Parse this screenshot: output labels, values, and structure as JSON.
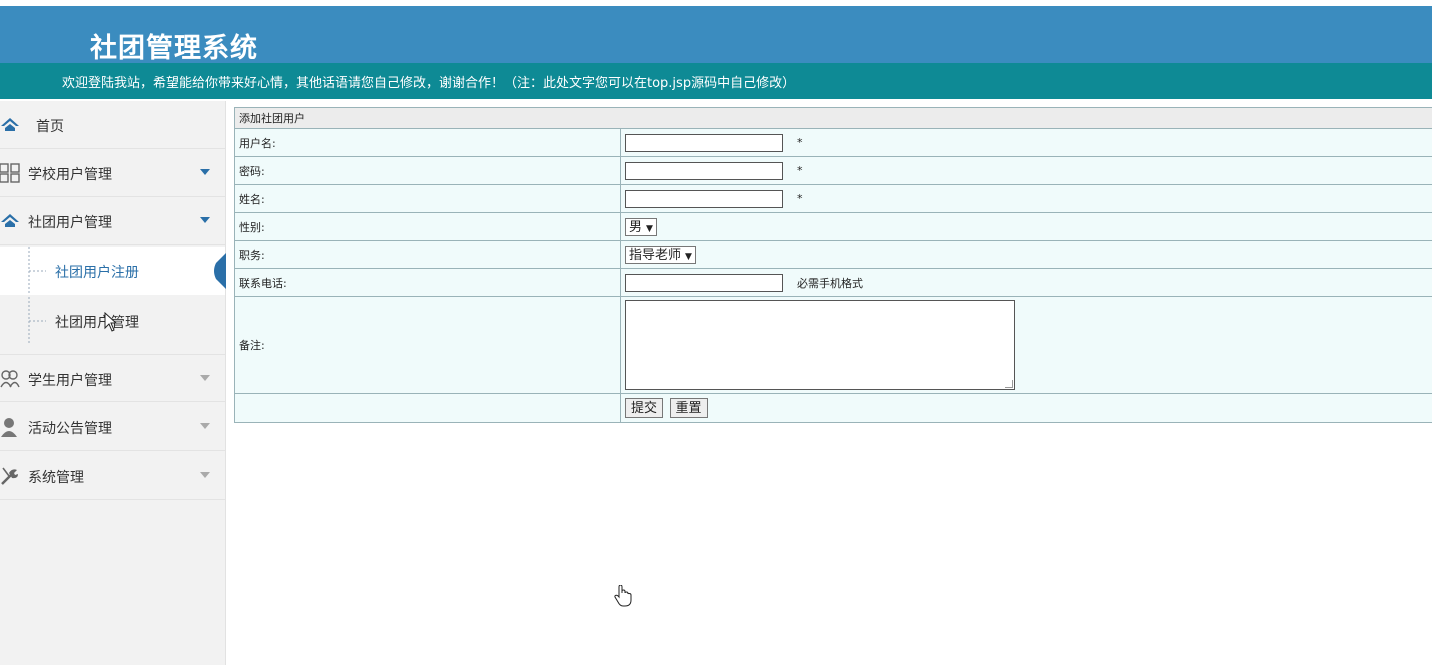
{
  "header": {
    "title": "社团管理系统",
    "welcome": "欢迎登陆我站，希望能给你带来好心情，其他话语请您自己修改，谢谢合作！（注：此处文字您可以在top.jsp源码中自己修改）"
  },
  "sidebar": {
    "items": [
      {
        "label": "首页",
        "icon": "home-icon"
      },
      {
        "label": "学校用户管理",
        "icon": "grid-icon"
      },
      {
        "label": "社团用户管理",
        "icon": "home-icon"
      },
      {
        "label": "学生用户管理",
        "icon": "users-icon"
      },
      {
        "label": "活动公告管理",
        "icon": "user-icon"
      },
      {
        "label": "系统管理",
        "icon": "tools-icon"
      }
    ],
    "subitems": [
      {
        "label": "社团用户注册"
      },
      {
        "label": "社团用户管理"
      }
    ]
  },
  "form": {
    "heading": "添加社团用户",
    "username_label": "用户名:",
    "password_label": "密码:",
    "name_label": "姓名:",
    "gender_label": "性别:",
    "gender_value": "男",
    "position_label": "职务:",
    "position_value": "指导老师",
    "phone_label": "联系电话:",
    "phone_hint": "必需手机格式",
    "remark_label": "备注:",
    "required_mark": "*",
    "submit_label": "提交",
    "reset_label": "重置"
  },
  "colors": {
    "header_bg": "#3b8cbf",
    "welcome_bg": "#0e8a95",
    "accent": "#2a6fa8",
    "form_bg": "#f0fbfb"
  }
}
